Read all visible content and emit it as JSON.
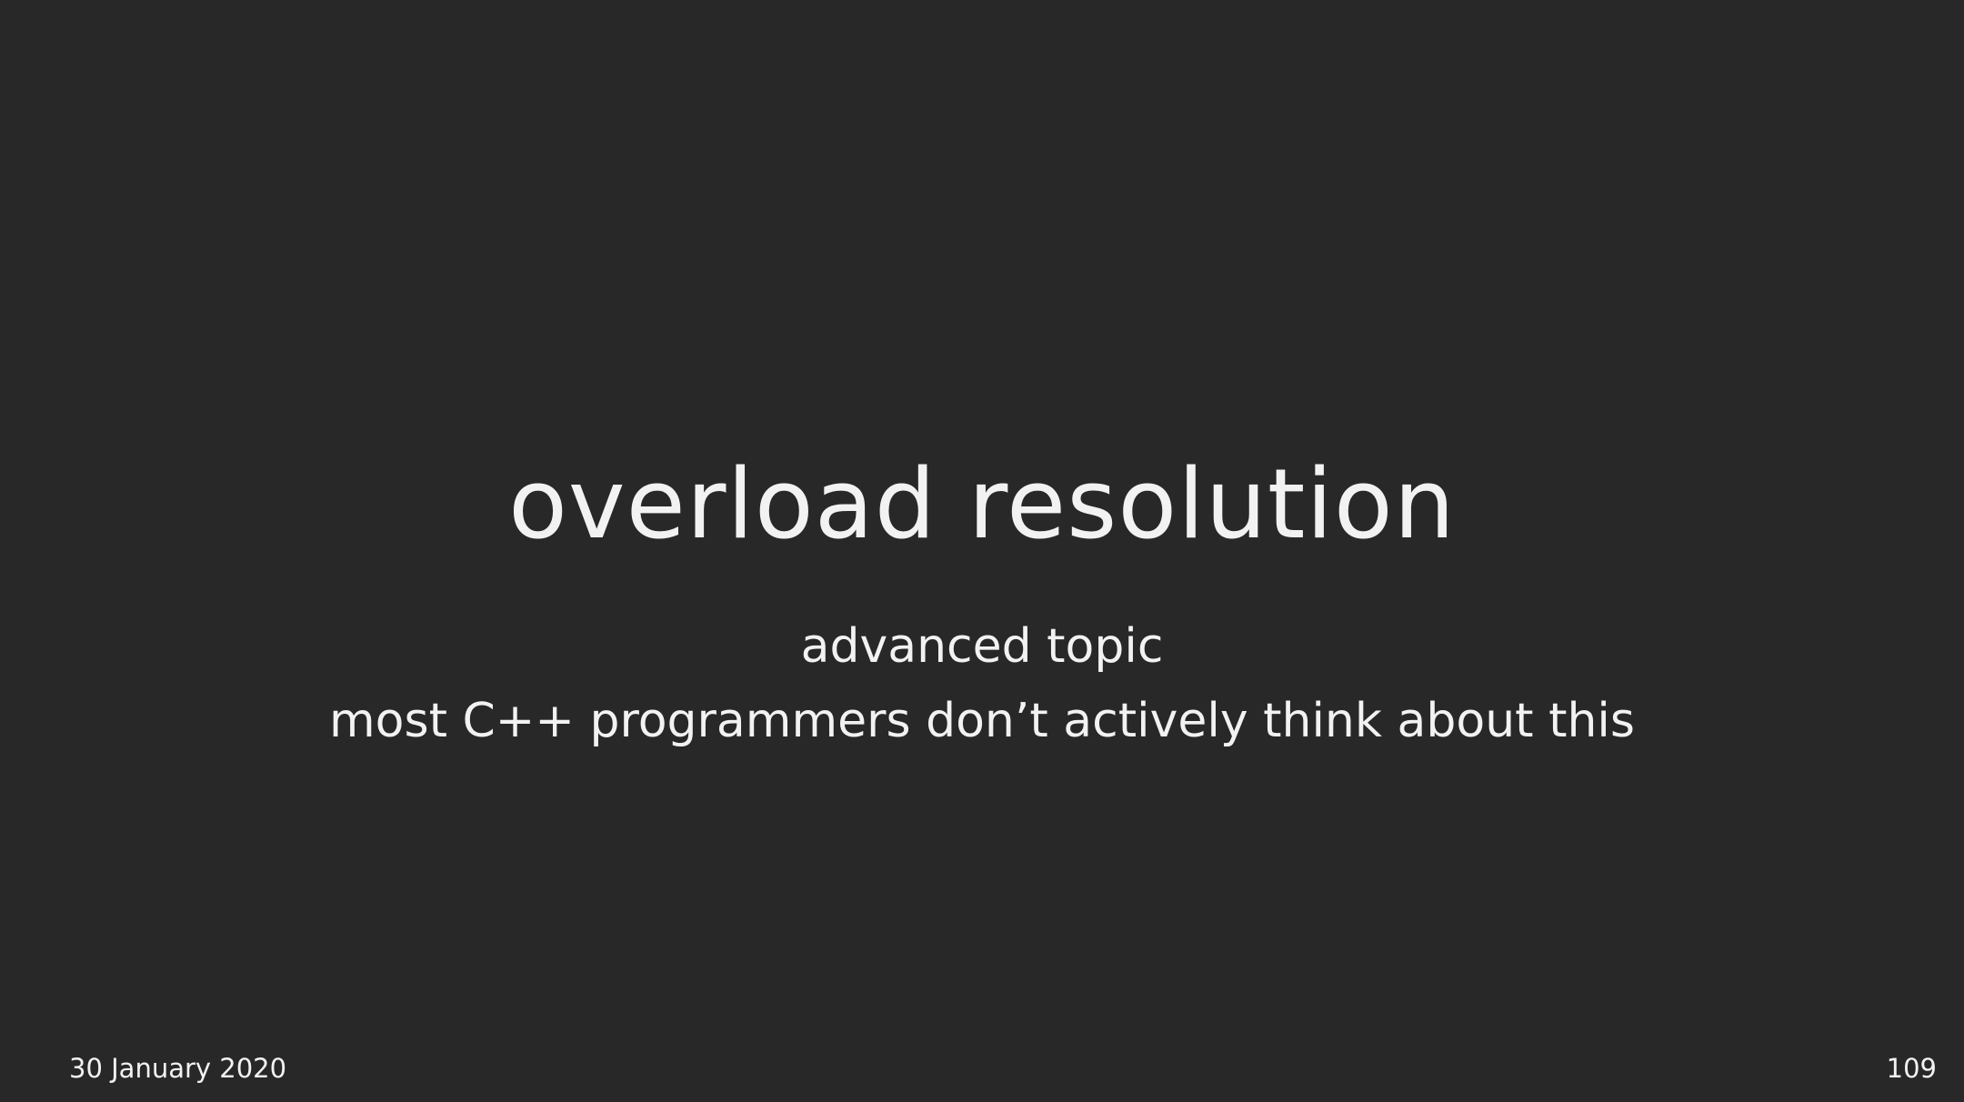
{
  "slide": {
    "title": "overload resolution",
    "subtitle_lines": [
      "advanced topic",
      "most C++ programmers don’t actively think about this"
    ],
    "footer": {
      "date": "30 January 2020",
      "page_number": "109"
    }
  },
  "colors": {
    "background": "#282828",
    "text": "#f2f2f2"
  }
}
